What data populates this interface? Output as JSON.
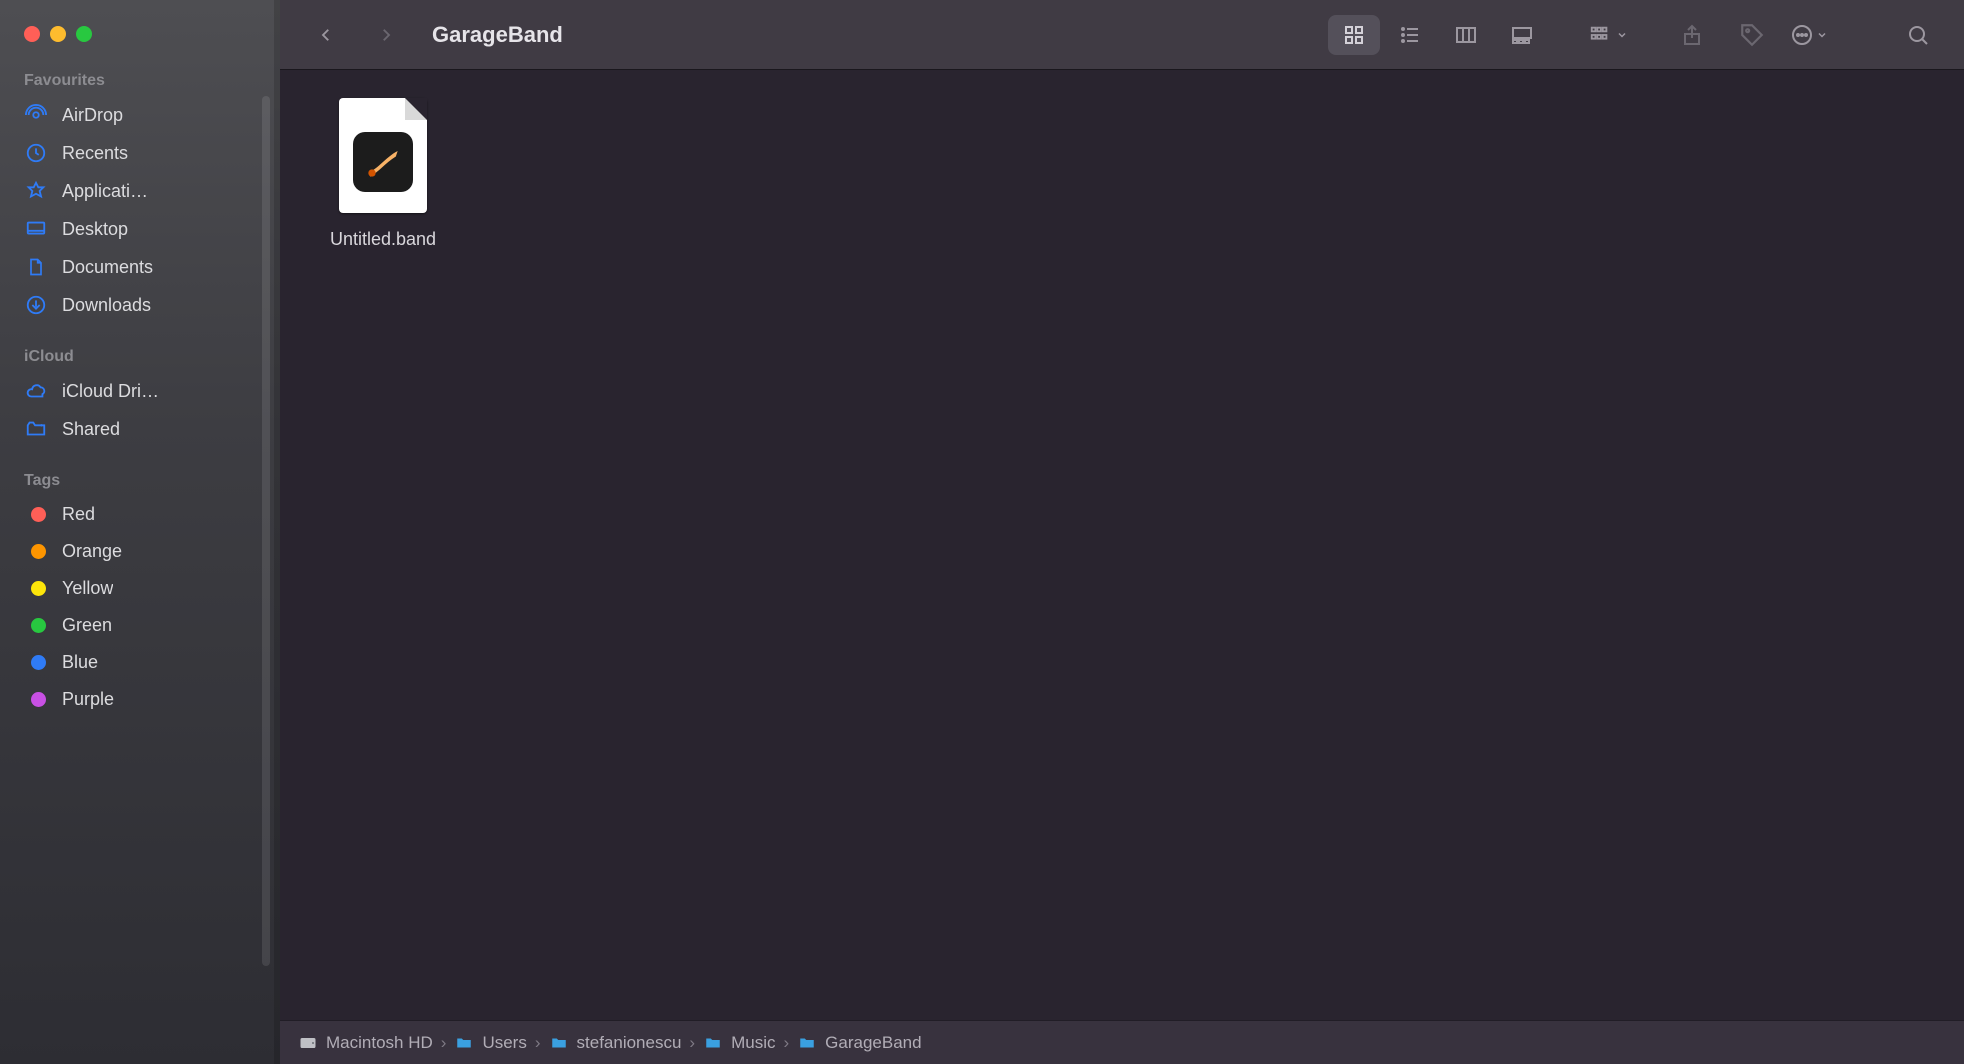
{
  "window": {
    "title": "GarageBand"
  },
  "traffic": {
    "close": "#ff5f57",
    "min": "#febc2e",
    "max": "#28c840"
  },
  "sidebar": {
    "groups": [
      {
        "label": "Favourites",
        "items": [
          {
            "name": "airdrop",
            "icon": "airdrop-icon",
            "label": "AirDrop"
          },
          {
            "name": "recents",
            "icon": "clock-icon",
            "label": "Recents"
          },
          {
            "name": "applications",
            "icon": "appstore-icon",
            "label": "Applicati…"
          },
          {
            "name": "desktop",
            "icon": "desktop-icon",
            "label": "Desktop"
          },
          {
            "name": "documents",
            "icon": "document-icon",
            "label": "Documents"
          },
          {
            "name": "downloads",
            "icon": "download-icon",
            "label": "Downloads"
          }
        ]
      },
      {
        "label": "iCloud",
        "items": [
          {
            "name": "icloud-drive",
            "icon": "cloud-icon",
            "label": "iCloud Dri…"
          },
          {
            "name": "shared",
            "icon": "sharedfolder-icon",
            "label": "Shared"
          }
        ]
      },
      {
        "label": "Tags",
        "items": [
          {
            "name": "tag-red",
            "icon": "tag-dot",
            "label": "Red",
            "color": "#ff5f57"
          },
          {
            "name": "tag-orange",
            "icon": "tag-dot",
            "label": "Orange",
            "color": "#fd9500"
          },
          {
            "name": "tag-yellow",
            "icon": "tag-dot",
            "label": "Yellow",
            "color": "#fde50a"
          },
          {
            "name": "tag-green",
            "icon": "tag-dot",
            "label": "Green",
            "color": "#28c840"
          },
          {
            "name": "tag-blue",
            "icon": "tag-dot",
            "label": "Blue",
            "color": "#2f7bf6"
          },
          {
            "name": "tag-purple",
            "icon": "tag-dot",
            "label": "Purple",
            "color": "#c850e4"
          }
        ]
      }
    ]
  },
  "toolbar": {
    "back": "Back",
    "forward": "Forward",
    "views": {
      "icon": "Icon",
      "list": "List",
      "column": "Column",
      "gallery": "Gallery",
      "active": "icon"
    },
    "group": "Group",
    "share": "Share",
    "tags": "Tags",
    "actions": "Actions",
    "search": "Search"
  },
  "content": {
    "files": [
      {
        "name": "Untitled.band",
        "kind": "garageband"
      }
    ]
  },
  "pathbar": {
    "crumbs": [
      {
        "icon": "disk-icon",
        "label": "Macintosh HD"
      },
      {
        "icon": "folder-icon",
        "label": "Users"
      },
      {
        "icon": "folder-icon",
        "label": "stefanionescu"
      },
      {
        "icon": "folder-icon",
        "label": "Music"
      },
      {
        "icon": "folder-icon",
        "label": "GarageBand"
      }
    ]
  }
}
